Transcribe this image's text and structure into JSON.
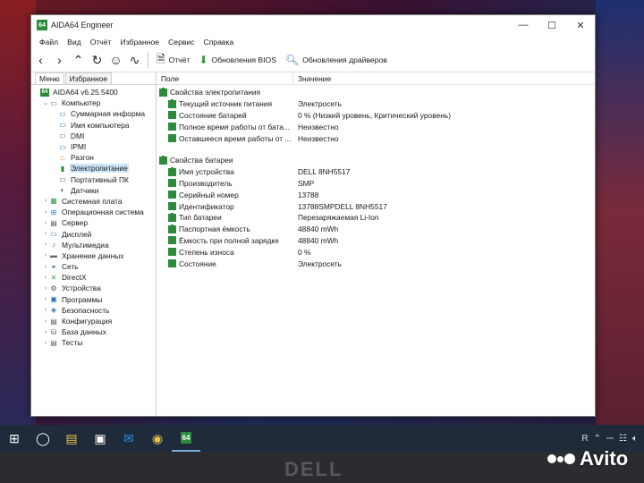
{
  "window": {
    "title": "AIDA64 Engineer",
    "app_icon_text": "64",
    "controls": {
      "minimize": "—",
      "maximize": "☐",
      "close": "✕"
    }
  },
  "menu": [
    "Файл",
    "Вид",
    "Отчёт",
    "Избранное",
    "Сервис",
    "Справка"
  ],
  "toolbar": {
    "report_label": "Отчёт",
    "bios_label": "Обновления BIOS",
    "drivers_label": "Обновления драйверов"
  },
  "left_tabs": [
    "Меню",
    "Избранное"
  ],
  "tree": [
    {
      "label": "AIDA64 v6.25.5400",
      "icon": "aida-icon",
      "level": 0,
      "exp": ""
    },
    {
      "label": "Компьютер",
      "icon": "computer-icon",
      "level": 1,
      "exp": "⌄"
    },
    {
      "label": "Суммарная информа",
      "icon": "monitor-icon",
      "level": 2,
      "exp": ""
    },
    {
      "label": "Имя компьютера",
      "icon": "monitor-icon",
      "level": 2,
      "exp": ""
    },
    {
      "label": "DMI",
      "icon": "monitor-icon",
      "level": 2,
      "exp": ""
    },
    {
      "label": "IPMI",
      "icon": "monitor-icon",
      "level": 2,
      "exp": ""
    },
    {
      "label": "Разгон",
      "icon": "flame-icon",
      "level": 2,
      "exp": ""
    },
    {
      "label": "Электропитание",
      "icon": "battery-icon",
      "level": 2,
      "exp": "",
      "selected": true
    },
    {
      "label": "Портативный ПК",
      "icon": "laptop-icon",
      "level": 2,
      "exp": ""
    },
    {
      "label": "Датчики",
      "icon": "sensor-icon",
      "level": 2,
      "exp": ""
    },
    {
      "label": "Системная плата",
      "icon": "motherboard-icon",
      "level": 1,
      "exp": "›"
    },
    {
      "label": "Операционная система",
      "icon": "windows-icon",
      "level": 1,
      "exp": "›"
    },
    {
      "label": "Сервер",
      "icon": "server-icon",
      "level": 1,
      "exp": "›"
    },
    {
      "label": "Дисплей",
      "icon": "display-icon",
      "level": 1,
      "exp": "›"
    },
    {
      "label": "Мультимедиа",
      "icon": "multimedia-icon",
      "level": 1,
      "exp": "›"
    },
    {
      "label": "Хранение данных",
      "icon": "storage-icon",
      "level": 1,
      "exp": "›"
    },
    {
      "label": "Сеть",
      "icon": "network-icon",
      "level": 1,
      "exp": "›"
    },
    {
      "label": "DirectX",
      "icon": "directx-icon",
      "level": 1,
      "exp": "›"
    },
    {
      "label": "Устройства",
      "icon": "devices-icon",
      "level": 1,
      "exp": "›"
    },
    {
      "label": "Программы",
      "icon": "programs-icon",
      "level": 1,
      "exp": "›"
    },
    {
      "label": "Безопасность",
      "icon": "shield-icon",
      "level": 1,
      "exp": "›"
    },
    {
      "label": "Конфигурация",
      "icon": "config-icon",
      "level": 1,
      "exp": "›"
    },
    {
      "label": "База данных",
      "icon": "database-icon",
      "level": 1,
      "exp": "›"
    },
    {
      "label": "Тесты",
      "icon": "tests-icon",
      "level": 1,
      "exp": "›"
    }
  ],
  "columns": {
    "field": "Поле",
    "value": "Значение"
  },
  "groups": [
    {
      "title": "Свойства электропитания",
      "rows": [
        {
          "field": "Текущий источник питания",
          "value": "Электросеть"
        },
        {
          "field": "Состояние батарей",
          "value": "0 % (Низкий уровень, Критический уровень)"
        },
        {
          "field": "Полное время работы от бата...",
          "value": "Неизвестно"
        },
        {
          "field": "Оставшееся время работы от ...",
          "value": "Неизвестно"
        }
      ]
    },
    {
      "title": "Свойства батареи",
      "rows": [
        {
          "field": "Имя устройства",
          "value": "DELL 8NH5517"
        },
        {
          "field": "Производитель",
          "value": "SMP"
        },
        {
          "field": "Серийный номер",
          "value": "13788"
        },
        {
          "field": "Идентификатор",
          "value": "13788SMPDELL 8NH5517"
        },
        {
          "field": "Тип батареи",
          "value": "Перезаряжаемая Li-Ion"
        },
        {
          "field": "Паспортная ёмкость",
          "value": "48840 mWh"
        },
        {
          "field": "Ёмкость при полной зарядке",
          "value": "48840 mWh"
        },
        {
          "field": "Степень износа",
          "value": "0 %"
        },
        {
          "field": "Состояние",
          "value": "Электросеть"
        }
      ]
    }
  ],
  "taskbar": {
    "aida_label": "64",
    "tray_text": "R"
  },
  "bezel_brand": "DELL",
  "watermark": "Avito",
  "colors": {
    "battery_green": "#2e8b3c",
    "selection": "#cce4f7"
  }
}
